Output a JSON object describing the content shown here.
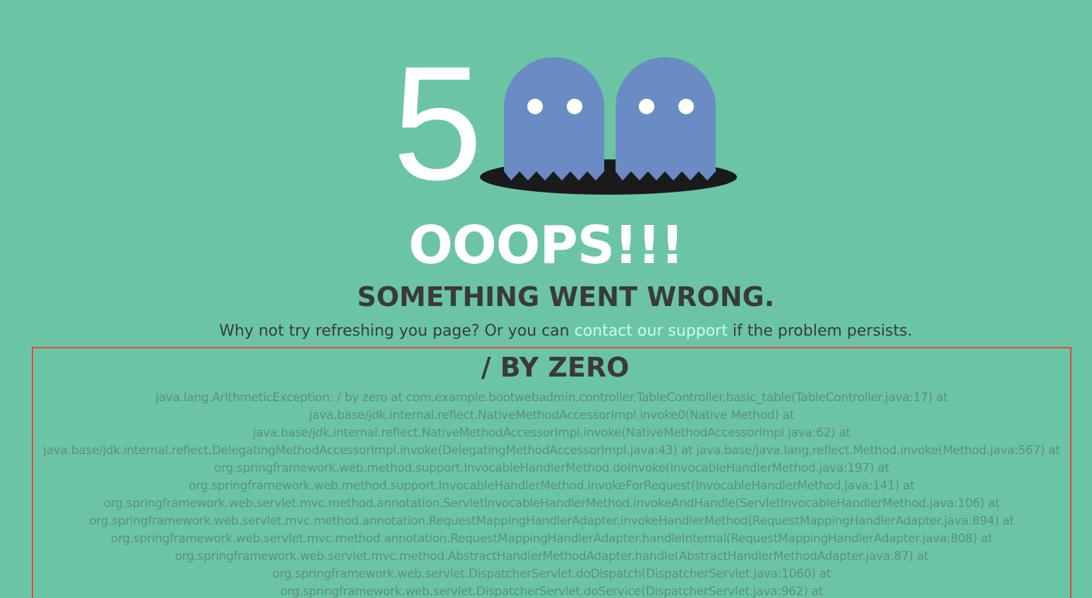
{
  "hero": {
    "code_digit": "5",
    "icons": [
      "ghost-icon",
      "ghost-icon",
      "hole-icon"
    ]
  },
  "headline": "OOOPS!!!",
  "subheadline": "SOMETHING WENT WRONG.",
  "message": {
    "before": "Why not try refreshing you page? Or you can ",
    "link": "contact our support",
    "after": " if the problem persists."
  },
  "error": {
    "title": "/ BY ZERO",
    "trace_lines": [
      "java.lang.ArithmeticException: / by zero at com.example.bootwebadmin.controller.TableController.basic_table(TableController.java:17) at",
      "java.base/jdk.internal.reflect.NativeMethodAccessorImpl.invoke0(Native Method) at",
      "java.base/jdk.internal.reflect.NativeMethodAccessorImpl.invoke(NativeMethodAccessorImpl.java:62) at",
      "java.base/jdk.internal.reflect.DelegatingMethodAccessorImpl.invoke(DelegatingMethodAccessorImpl.java:43) at java.base/java.lang.reflect.Method.invoke(Method.java:567) at",
      "org.springframework.web.method.support.InvocableHandlerMethod.doInvoke(InvocableHandlerMethod.java:197) at",
      "org.springframework.web.method.support.InvocableHandlerMethod.invokeForRequest(InvocableHandlerMethod.java:141) at",
      "org.springframework.web.servlet.mvc.method.annotation.ServletInvocableHandlerMethod.invokeAndHandle(ServletInvocableHandlerMethod.java:106) at",
      "org.springframework.web.servlet.mvc.method.annotation.RequestMappingHandlerAdapter.invokeHandlerMethod(RequestMappingHandlerAdapter.java:894) at",
      "org.springframework.web.servlet.mvc.method.annotation.RequestMappingHandlerAdapter.handleInternal(RequestMappingHandlerAdapter.java:808) at",
      "org.springframework.web.servlet.mvc.method.AbstractHandlerMethodAdapter.handle(AbstractHandlerMethodAdapter.java:87) at",
      "org.springframework.web.servlet.DispatcherServlet.doDispatch(DispatcherServlet.java:1060) at",
      "org.springframework.web.servlet.DispatcherServlet.doService(DispatcherServlet.java:962) at"
    ]
  },
  "colors": {
    "background": "#6bc5a4",
    "ghost": "#6a8bc4",
    "hole": "#1a1a1a",
    "link": "#c9ffe8",
    "error_border": "#e2473f"
  }
}
